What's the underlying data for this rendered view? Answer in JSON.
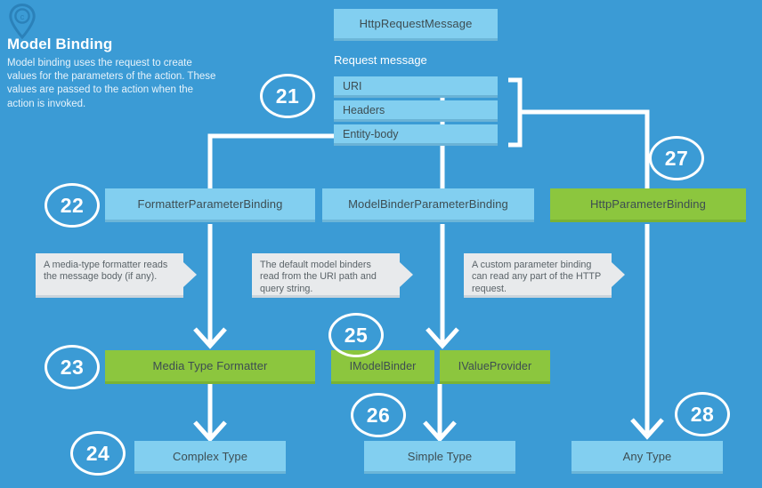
{
  "panel": {
    "icon": "map-pin-c-icon",
    "title": "Model Binding",
    "body": "Model binding uses the request to create values for the parameters of the action. These values are passed to the action when the action is invoked."
  },
  "colors": {
    "background": "#3b9bd5",
    "node_blue": "#82cff0",
    "node_green": "#8cc63e",
    "callout_gray": "#e8eaec",
    "line_white": "#ffffff",
    "node_text": "#3d4d52"
  },
  "request": {
    "header_label": "HttpRequestMessage",
    "caption": "Request message",
    "parts": [
      {
        "label": "URI"
      },
      {
        "label": "Headers"
      },
      {
        "label": "Entity-body"
      }
    ]
  },
  "bindings": [
    {
      "label": "FormatterParameterBinding",
      "style": "blue"
    },
    {
      "label": "ModelBinderParameterBinding",
      "style": "blue"
    },
    {
      "label": "HttpParameterBinding",
      "style": "green"
    }
  ],
  "callouts": [
    {
      "text": "A media-type formatter reads the message body (if any)."
    },
    {
      "text": "The default model binders read from the URI path and query string."
    },
    {
      "text": "A custom parameter binding can read any part of the HTTP request."
    }
  ],
  "implementations": [
    {
      "label": "Media Type Formatter",
      "style": "green"
    },
    {
      "label": "IModelBinder",
      "style": "green"
    },
    {
      "label": "IValueProvider",
      "style": "green"
    }
  ],
  "results": [
    {
      "label": "Complex Type",
      "style": "blue"
    },
    {
      "label": "Simple Type",
      "style": "blue"
    },
    {
      "label": "Any Type",
      "style": "blue"
    }
  ],
  "badges": [
    {
      "number": "21"
    },
    {
      "number": "22"
    },
    {
      "number": "23"
    },
    {
      "number": "24"
    },
    {
      "number": "25"
    },
    {
      "number": "26"
    },
    {
      "number": "27"
    },
    {
      "number": "28"
    }
  ]
}
